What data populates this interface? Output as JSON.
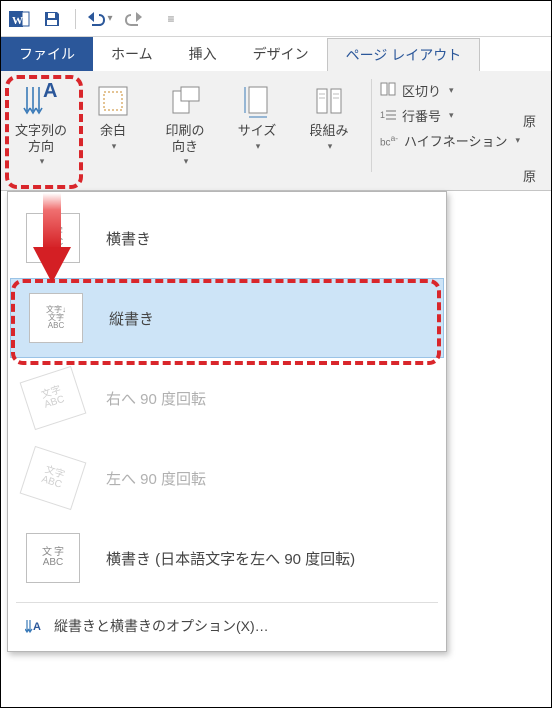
{
  "qat": {
    "undo_tip": "元に戻す",
    "redo_tip": "やり直し",
    "save_tip": "保存"
  },
  "tabs": {
    "file": "ファイル",
    "home": "ホーム",
    "insert": "挿入",
    "design": "デザイン",
    "layout": "ページ レイアウト"
  },
  "ribbon": {
    "text_direction": "文字列の\n方向",
    "margins": "余白",
    "orientation": "印刷の\n向き",
    "size": "サイズ",
    "columns": "段組み",
    "breaks": "区切り",
    "line_numbers": "行番号",
    "hyphenation": "ハイフネーション",
    "right_frag1": "原",
    "right_frag2": "原"
  },
  "dropdown": {
    "horizontal": "横書き",
    "vertical": "縦書き",
    "rotate_right": "右へ 90 度回転",
    "rotate_left": "左へ 90 度回転",
    "horizontal_jp_left": "横書き (日本語文字を左へ 90 度回転)",
    "options": "縦書きと横書きのオプション(X)…"
  },
  "thumbs": {
    "horizontal": "文字\nABC",
    "vertical": "文字↓\n文字\nABC",
    "rot_r": "文字\nABC",
    "rot_l": "文字\nABC",
    "jp_left": "文 字\nABC"
  }
}
